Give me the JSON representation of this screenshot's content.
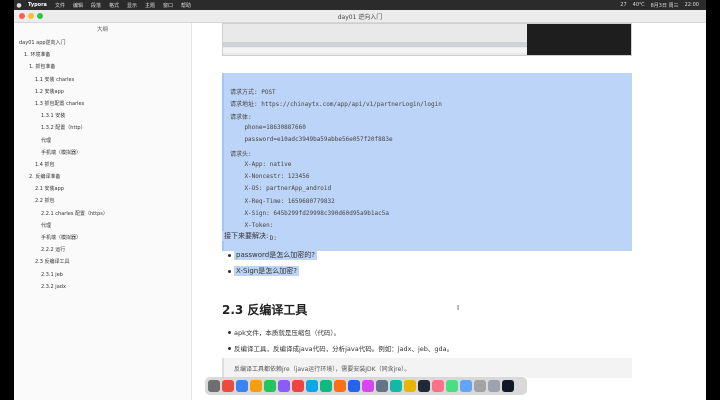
{
  "menubar": {
    "app": "Typora",
    "items": [
      "文件",
      "编辑",
      "段落",
      "格式",
      "显示",
      "主题",
      "窗口",
      "帮助"
    ],
    "right": [
      "27",
      "40℃",
      "8月3日 周三",
      "22:00"
    ]
  },
  "window": {
    "title": "day01 逆向入门"
  },
  "sidebar": {
    "header": "大纲",
    "items": [
      {
        "label": "day01 app逆向入门",
        "level": 1
      },
      {
        "label": "1. 环境准备",
        "level": 2
      },
      {
        "label": "1. 抓包准备",
        "level": 3
      },
      {
        "label": "1.1 安装 charles",
        "level": 4
      },
      {
        "label": "1.2 安装app",
        "level": 4
      },
      {
        "label": "1.3 抓包配置 charles",
        "level": 4
      },
      {
        "label": "1.3.1 安装",
        "level": 5
      },
      {
        "label": "1.3.2 配置（http）",
        "level": 5
      },
      {
        "label": "代理",
        "level": 5
      },
      {
        "label": "手机端（模拟器）",
        "level": 5
      },
      {
        "label": "1.4 抓包",
        "level": 4
      },
      {
        "label": "2. 反编译准备",
        "level": 3
      },
      {
        "label": "2.1 安装app",
        "level": 4
      },
      {
        "label": "2.2 抓包",
        "level": 4
      },
      {
        "label": "2.2.1 charles 配置（https）",
        "level": 5
      },
      {
        "label": "代理",
        "level": 5
      },
      {
        "label": "手机端（模拟器）",
        "level": 5
      },
      {
        "label": "2.2.2 运行",
        "level": 5
      },
      {
        "label": "2.3 反编译工具",
        "level": 4
      },
      {
        "label": "2.3.1 jeb",
        "level": 5
      },
      {
        "label": "2.3.2 jadx",
        "level": 5
      }
    ]
  },
  "editor": {
    "code_lines": [
      "请求方式: POST",
      "请求地址: https://chinaytx.com/app/api/v1/partnerLogin/login",
      "请求体:",
      "    phone=18630887660",
      "    password=e10adc3949ba59abbe56e057f20f883e",
      "请求头:",
      "    X-App: native",
      "    X-Noncestr: 123456",
      "    X-OS: partnerApp_android",
      "    X-Req-Time: 1659680779832",
      "    X-Sign: 645b299fd29998c390d60d95a9b1ac5a",
      "    X-Token:",
      "    X-UserID:"
    ],
    "next_label": "接下来要解决:",
    "bullets": [
      "password是怎么加密的?",
      "X-Sign是怎么加密?"
    ],
    "section_title": "2.3 反编译工具",
    "para_bullets": [
      "apk文件，本质就是压缩包（代码）。",
      "反编译工具，反编译成java代码，分析java代码。例如：jadx、jeb、gda。"
    ],
    "quote": "反编译工具都依赖jre（java运行环境），需要安装JDK（同含jre）。"
  },
  "dock": {
    "colors": [
      "#6f6f6f",
      "#e84d3d",
      "#3b82f6",
      "#f59e0b",
      "#22c55e",
      "#8b5cf6",
      "#ef4444",
      "#0ea5e9",
      "#10b981",
      "#f97316",
      "#2563eb",
      "#d946ef",
      "#64748b",
      "#14b8a6",
      "#eab308",
      "#1f2937",
      "#fb7185",
      "#4ade80",
      "#60a5fa",
      "#a3a3a3",
      "#9ca3af",
      "#111827"
    ]
  }
}
